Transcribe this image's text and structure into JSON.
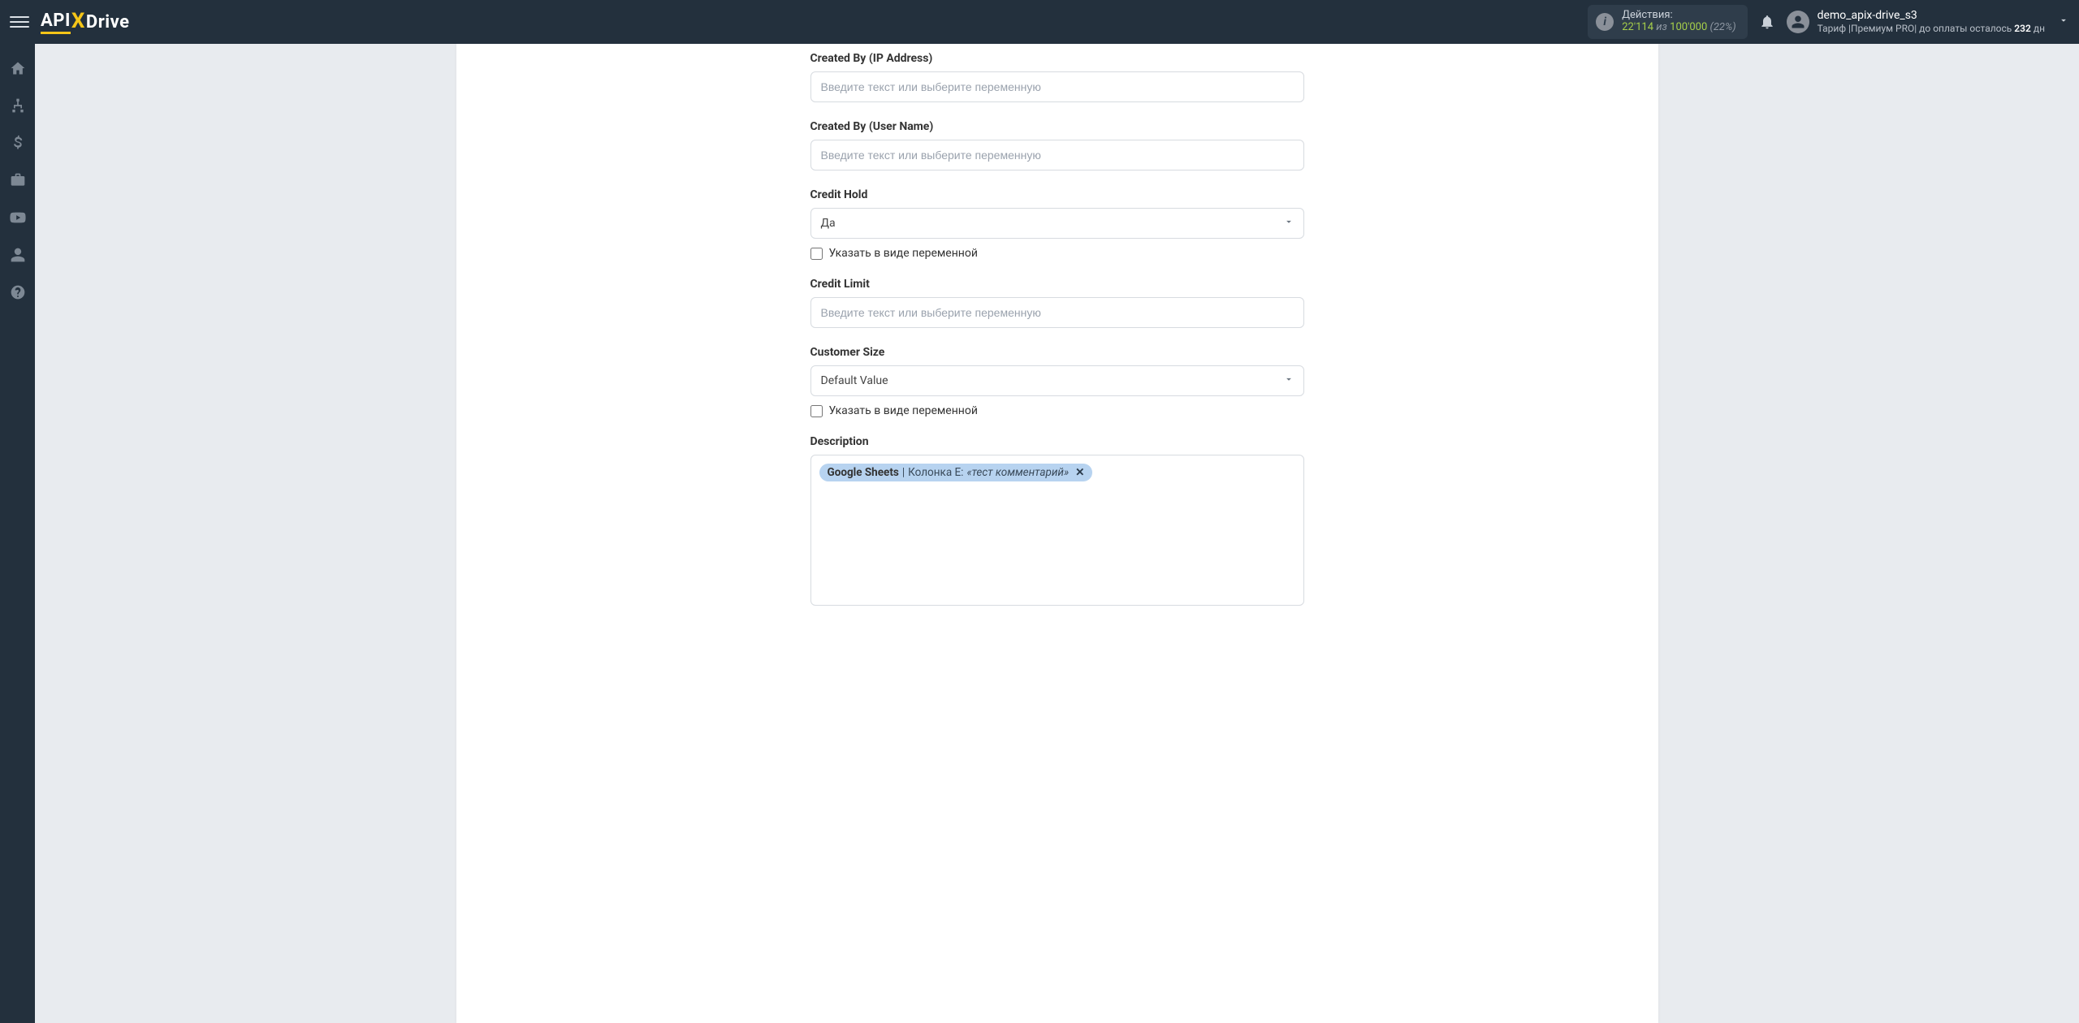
{
  "header": {
    "logo": {
      "part1": "API",
      "part2": "X",
      "part3": "Drive"
    },
    "actions": {
      "label": "Действия:",
      "used": "22'114",
      "iz": "из",
      "total": "100'000",
      "pct": "(22%)"
    },
    "user": {
      "name": "demo_apix-drive_s3",
      "tariff_prefix": "Тариф |",
      "tariff_name": "Премиум PRO",
      "tariff_mid": "| до оплаты осталось ",
      "days": "232",
      "days_suffix": " дн"
    }
  },
  "sidebar": {
    "items": [
      "home",
      "sitemap",
      "dollar",
      "briefcase",
      "youtube",
      "user",
      "help"
    ]
  },
  "form": {
    "placeholder_text": "Введите текст или выберите переменную",
    "fields": {
      "created_by_ip": {
        "label": "Created By (IP Address)"
      },
      "created_by_user": {
        "label": "Created By (User Name)"
      },
      "credit_hold": {
        "label": "Credit Hold",
        "value": "Да",
        "var_label": "Указать в виде переменной"
      },
      "credit_limit": {
        "label": "Credit Limit"
      },
      "customer_size": {
        "label": "Customer Size",
        "value": "Default Value",
        "var_label": "Указать в виде переменной"
      },
      "description": {
        "label": "Description",
        "token": {
          "source": "Google Sheets",
          "sep": " | ",
          "col": "Колонка E: ",
          "value": "«тест комментарий»"
        }
      }
    }
  }
}
